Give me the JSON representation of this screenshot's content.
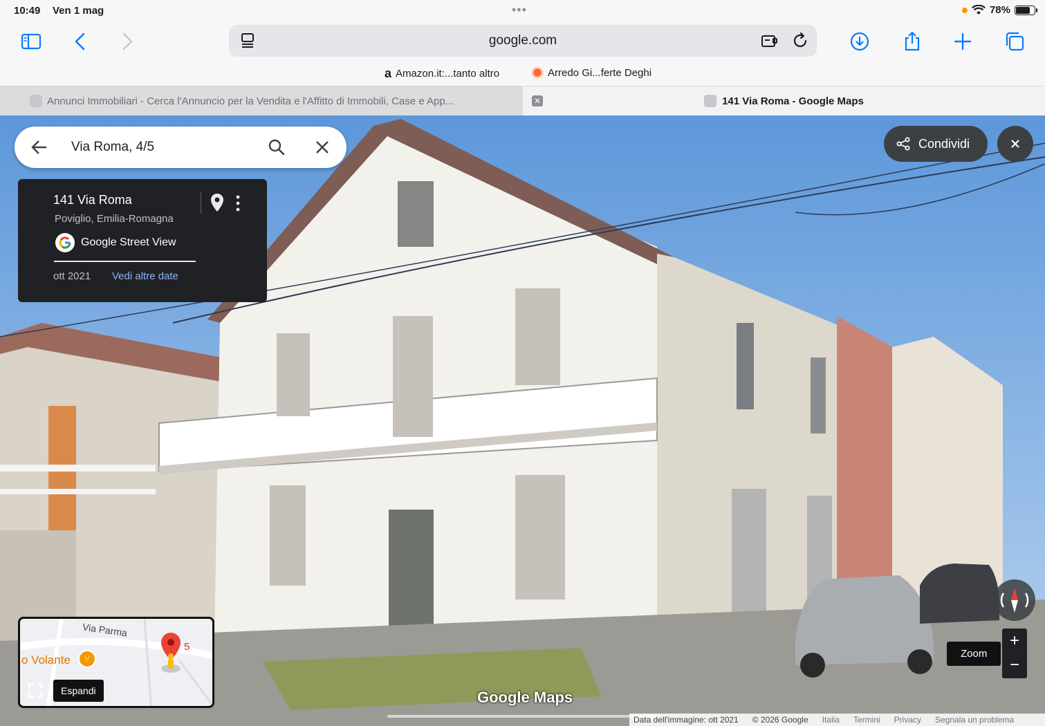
{
  "status_bar": {
    "time": "10:49",
    "date": "Ven 1 mag",
    "battery": "78%",
    "battery_level": 0.78,
    "icons": [
      "wifi-icon",
      "battery-icon",
      "recording-dot-icon"
    ]
  },
  "browser": {
    "url": "google.com",
    "toolbar_icons": [
      "sidebar-icon",
      "back-icon",
      "forward-icon",
      "reader-icon",
      "extension-icon",
      "reload-icon",
      "download-icon",
      "share-icon",
      "new-tab-icon",
      "tabs-overview-icon"
    ],
    "bookmarks": [
      {
        "label": "Amazon.it:...tanto altro",
        "icon": "amazon-icon"
      },
      {
        "label": "Arredo Gi...ferte Deghi",
        "icon": "arredo-icon"
      }
    ],
    "tabs": [
      {
        "label": "Annunci Immobiliari - Cerca l'Annuncio per la Vendita e l'Affitto di Immobili, Case e App...",
        "active": false
      },
      {
        "label": "141 Via Roma - Google Maps",
        "active": true
      }
    ]
  },
  "maps": {
    "search": {
      "query": "Via Roma, 4/5"
    },
    "card": {
      "title": "141 Via Roma",
      "region": "Poviglio, Emilia-Romagna",
      "source": "Google Street View",
      "date": "ott 2021",
      "more_dates": "Vedi altre date"
    },
    "share_label": "Condividi",
    "minimap": {
      "street": "Via Parma",
      "poi": "o Volante",
      "number": "5",
      "expand_label": "Espandi"
    },
    "zoom_label": "Zoom",
    "zoom_in": "+",
    "zoom_out": "−",
    "watermark": "Google Maps",
    "footer": {
      "image_date": "Data dell'immagine: ott 2021",
      "copyright": "© 2026 Google",
      "links": [
        "Italia",
        "Termini",
        "Privacy",
        "Segnala un problema"
      ]
    }
  },
  "colors": {
    "accent": "#0a7aff",
    "card_bg": "#202124",
    "link": "#8ab4f8",
    "sky": "#6fa6e0",
    "facade": "#f1efe9"
  }
}
